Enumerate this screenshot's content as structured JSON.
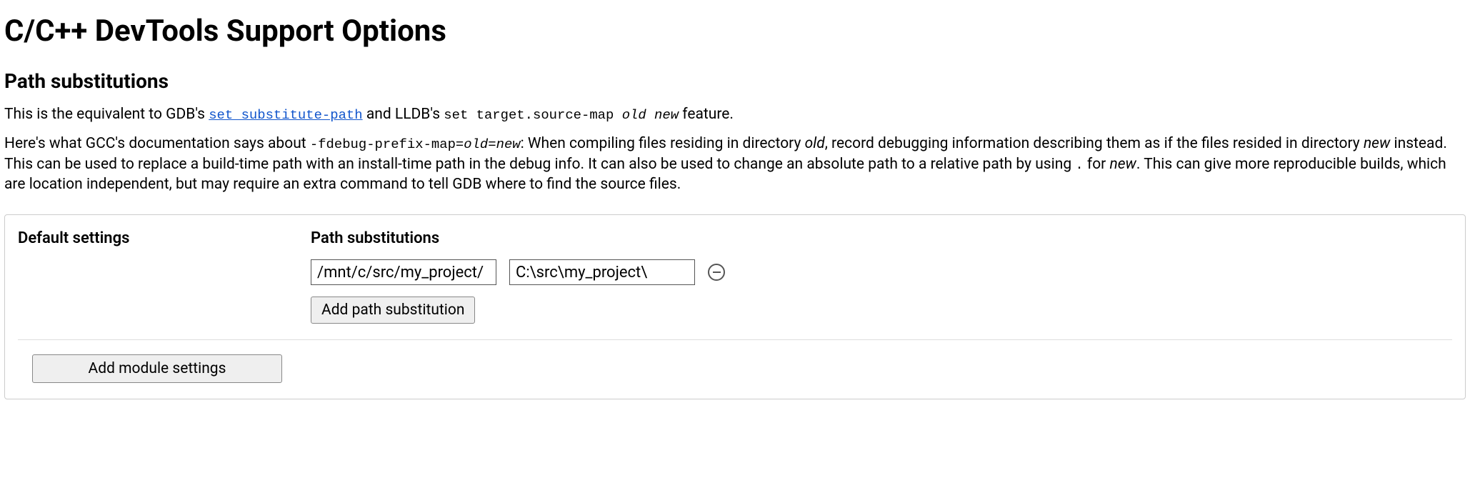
{
  "page_title": "C/C++ DevTools Support Options",
  "section_title": "Path substitutions",
  "intro": {
    "prefix": "This is the equivalent to GDB's ",
    "gdb_link": "set substitute-path",
    "mid": " and LLDB's ",
    "lldb_cmd": "set target.source-map ",
    "lldb_args_old": "old",
    "lldb_args_sep": " ",
    "lldb_args_new": "new",
    "suffix": " feature."
  },
  "doc": {
    "p1a": "Here's what GCC's documentation says about ",
    "flag": "-fdebug-prefix-map=",
    "flag_old": "old",
    "flag_eq": "=",
    "flag_new": "new",
    "p1b": ": When compiling files residing in directory ",
    "dir_old": "old",
    "p1c": ", record debugging information describing them as if the files resided in directory ",
    "dir_new": "new",
    "p1d": " instead. This can be used to replace a build-time path with an install-time path in the debug info. It can also be used to change an absolute path to a relative path by using ",
    "dot": ".",
    "p1e": " for ",
    "dir_new2": "new",
    "p1f": ". This can give more reproducible builds, which are location independent, but may require an extra command to tell GDB where to find the source files."
  },
  "panel": {
    "default_label": "Default settings",
    "subst_label": "Path substitutions",
    "row": {
      "from": "/mnt/c/src/my_project/",
      "to": "C:\\src\\my_project\\"
    },
    "add_subst": "Add path substitution",
    "add_module": "Add module settings"
  }
}
